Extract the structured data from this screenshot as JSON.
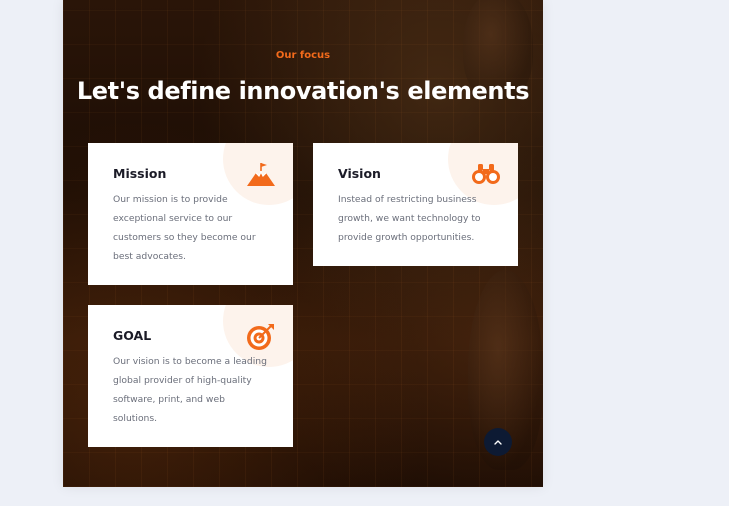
{
  "section": {
    "eyebrow": "Our focus",
    "title": "Let's define innovation's elements"
  },
  "cards": [
    {
      "title": "Mission",
      "text_lines": [
        "Our mission is to provide",
        "exceptional service to our",
        "customers so they become our",
        "best advocates."
      ],
      "icon": "mountain-flag-icon"
    },
    {
      "title": "Vision",
      "text_lines": [
        "Instead of restricting business",
        "growth, we want technology to",
        "provide growth opportunities."
      ],
      "icon": "binoculars-icon"
    },
    {
      "title": "GOAL",
      "text_lines": [
        "Our vision is to become a leading",
        "global provider of high-quality",
        "software, print, and web",
        "solutions."
      ],
      "icon": "target-arrow-icon"
    }
  ],
  "scroll_top": {
    "icon": "chevron-up-icon"
  },
  "colors": {
    "accent": "#f26a1b",
    "page_background": "#edf0f7",
    "card_background": "#ffffff",
    "heading_text": "#1b1b27",
    "body_text": "#6b6f7b",
    "scroll_button": "#0d1a33"
  }
}
